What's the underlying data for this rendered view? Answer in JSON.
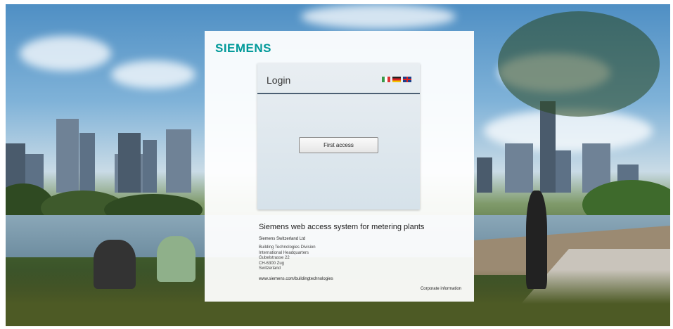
{
  "brand": {
    "logo": "SIEMENS",
    "color": "#009999"
  },
  "login": {
    "title": "Login",
    "languages": [
      "it-flag-icon",
      "de-flag-icon",
      "uk-flag-icon"
    ],
    "first_access_button": "First access"
  },
  "info": {
    "system_title": "Siemens web access system for metering plants",
    "company": "Siemens Switzerland Ltd",
    "address_lines": [
      "Building Technologies Division",
      "International Headquarters",
      "Gubelstrasse 22",
      "CH-6300 Zug",
      "Switzerland"
    ],
    "website": "www.siemens.com/buildingtechnologies",
    "corporate_link": "Corporate information"
  }
}
